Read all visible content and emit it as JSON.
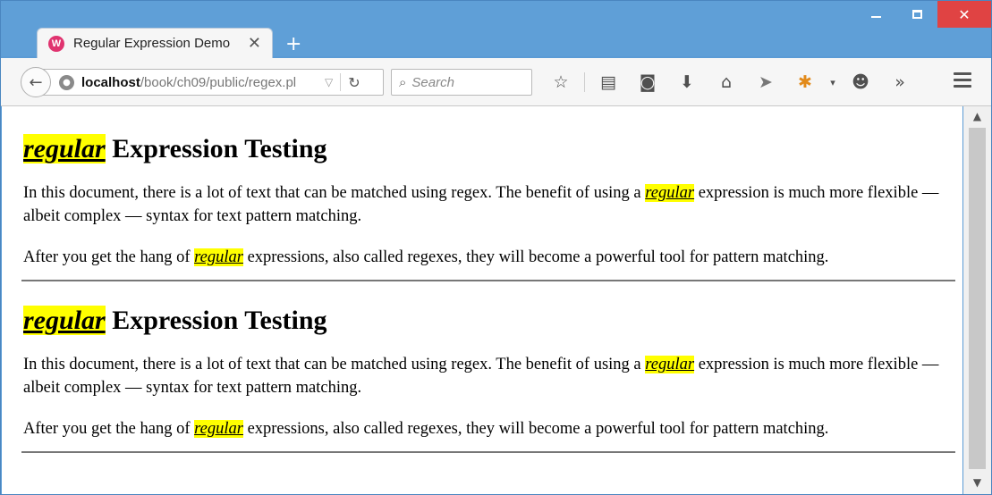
{
  "window": {
    "controls": {
      "minimize": "",
      "maximize": "",
      "close": "✕"
    }
  },
  "tab": {
    "title": "Regular Expression Demo",
    "favicon_text": "W",
    "close_glyph": "✕",
    "new_tab_glyph": "+"
  },
  "nav": {
    "back_glyph": "←",
    "url_host": "localhost",
    "url_path": "/book/ch09/public/regex.pl",
    "dropdown_glyph": "▽",
    "reload_glyph": "↻",
    "search_placeholder": "Search",
    "icons": [
      {
        "name": "bookmark-star-icon",
        "glyph": "☆"
      },
      {
        "name": "reading-list-icon",
        "glyph": "▤"
      },
      {
        "name": "pocket-icon",
        "glyph": "◙"
      },
      {
        "name": "download-icon",
        "glyph": "⬇"
      },
      {
        "name": "home-icon",
        "glyph": "⌂"
      },
      {
        "name": "send-icon",
        "glyph": "➤"
      },
      {
        "name": "firebug-icon",
        "glyph": "✱"
      },
      {
        "name": "dropdown-arrow-icon",
        "glyph": "▾"
      },
      {
        "name": "smiley-icon",
        "glyph": "☻"
      },
      {
        "name": "overflow-chevron-icon",
        "glyph": "»"
      }
    ]
  },
  "page": {
    "sections": [
      {
        "heading_highlight": "regular",
        "heading_rest": " Expression Testing",
        "p1_before": "In this document, there is a lot of text that can be matched using regex. The benefit of using a ",
        "p1_highlight": "regular",
        "p1_after": " expression is much more flexible — albeit complex — syntax for text pattern matching.",
        "p2_before": "After you get the hang of ",
        "p2_highlight": "regular",
        "p2_after": " expressions, also called regexes, they will become a powerful tool for pattern matching."
      },
      {
        "heading_highlight": "regular",
        "heading_rest": " Expression Testing",
        "p1_before": "In this document, there is a lot of text that can be matched using regex. The benefit of using a ",
        "p1_highlight": "regular",
        "p1_after": " expression is much more flexible — albeit complex — syntax for text pattern matching.",
        "p2_before": "After you get the hang of ",
        "p2_highlight": "regular",
        "p2_after": " expressions, also called regexes, they will become a powerful tool for pattern matching."
      }
    ],
    "highlight_color": "#ffff00"
  },
  "scrollbar": {
    "up_glyph": "▲",
    "down_glyph": "▼"
  }
}
